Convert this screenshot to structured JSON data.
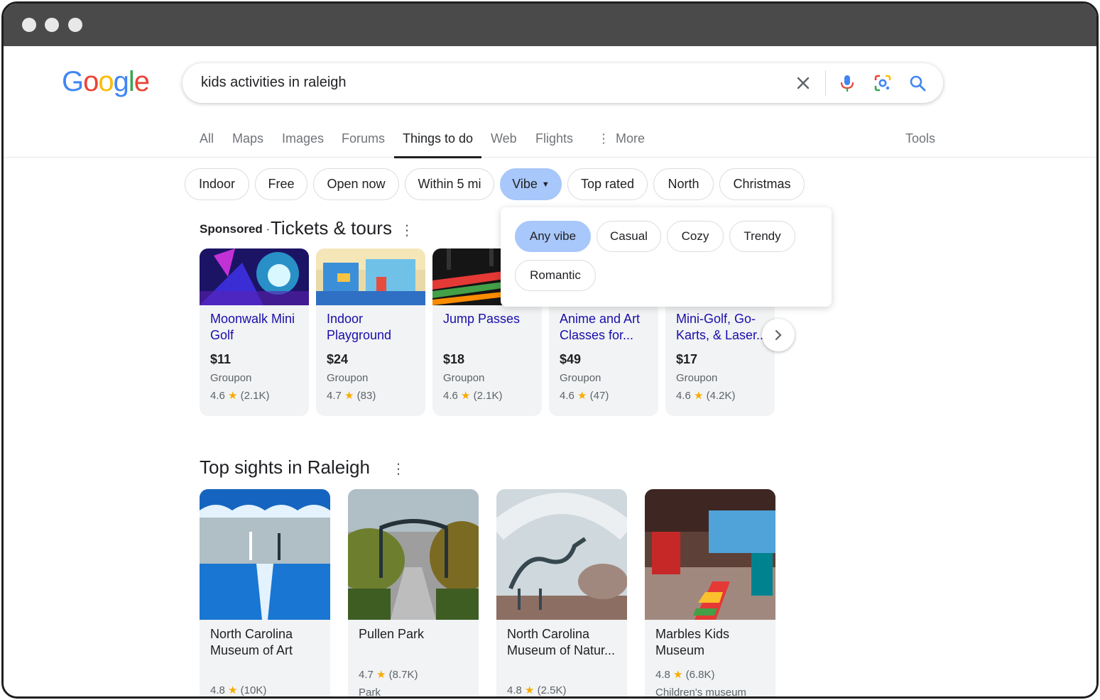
{
  "search": {
    "query": "kids activities in raleigh"
  },
  "logo": {
    "letters": [
      "G",
      "o",
      "o",
      "g",
      "l",
      "e"
    ],
    "colors": [
      "#4285F4",
      "#EA4335",
      "#FBBC05",
      "#4285F4",
      "#34A853",
      "#EA4335"
    ]
  },
  "tabs": [
    {
      "label": "All"
    },
    {
      "label": "Maps"
    },
    {
      "label": "Images"
    },
    {
      "label": "Forums"
    },
    {
      "label": "Things to do"
    },
    {
      "label": "Web"
    },
    {
      "label": "Flights"
    },
    {
      "label": "More"
    }
  ],
  "tools_label": "Tools",
  "chips": [
    {
      "label": "Indoor"
    },
    {
      "label": "Free"
    },
    {
      "label": "Open now"
    },
    {
      "label": "Within 5 mi"
    },
    {
      "label": "Vibe"
    },
    {
      "label": "Top rated"
    },
    {
      "label": "North"
    },
    {
      "label": "Christmas"
    }
  ],
  "vibe_options": [
    {
      "label": "Any vibe"
    },
    {
      "label": "Casual"
    },
    {
      "label": "Cozy"
    },
    {
      "label": "Trendy"
    },
    {
      "label": "Romantic"
    }
  ],
  "tickets": {
    "sponsored_label": "Sponsored",
    "separator": "·",
    "title": "Tickets & tours",
    "cards": [
      {
        "name": "Moonwalk Mini Golf",
        "price": "$11",
        "vendor": "Groupon",
        "rating": "4.6",
        "reviews": "(2.1K)"
      },
      {
        "name": "Indoor Playground",
        "price": "$24",
        "vendor": "Groupon",
        "rating": "4.7",
        "reviews": "(83)"
      },
      {
        "name": "Jump Passes",
        "price": "$18",
        "vendor": "Groupon",
        "rating": "4.6",
        "reviews": "(2.1K)"
      },
      {
        "name": "Anime and Art Classes for...",
        "price": "$49",
        "vendor": "Groupon",
        "rating": "4.6",
        "reviews": "(47)"
      },
      {
        "name": "Mini-Golf, Go-Karts, & Laser...",
        "price": "$17",
        "vendor": "Groupon",
        "rating": "4.6",
        "reviews": "(4.2K)"
      }
    ]
  },
  "sights": {
    "title": "Top sights in Raleigh",
    "cards": [
      {
        "name": "North Carolina Museum of Art",
        "rating": "4.8",
        "reviews": "(10K)",
        "type": ""
      },
      {
        "name": "Pullen Park",
        "rating": "4.7",
        "reviews": "(8.7K)",
        "type": "Park"
      },
      {
        "name": "North Carolina Museum of Natur...",
        "rating": "4.8",
        "reviews": "(2.5K)",
        "type": ""
      },
      {
        "name": "Marbles Kids Museum",
        "rating": "4.8",
        "reviews": "(6.8K)",
        "type": "Children's museum"
      }
    ]
  },
  "icons": {
    "clear": "close-icon",
    "voice": "microphone-icon",
    "lens": "camera-lens-icon",
    "search": "search-icon",
    "more": "kebab-menu-icon",
    "next": "chevron-right-icon",
    "dropdown": "caret-down-icon",
    "rating": "star-icon"
  },
  "colors": {
    "link": "#1a0dab",
    "selected_chip": "#a8c7fa",
    "star": "#f9ab00",
    "card_bg": "#f1f3f4"
  }
}
